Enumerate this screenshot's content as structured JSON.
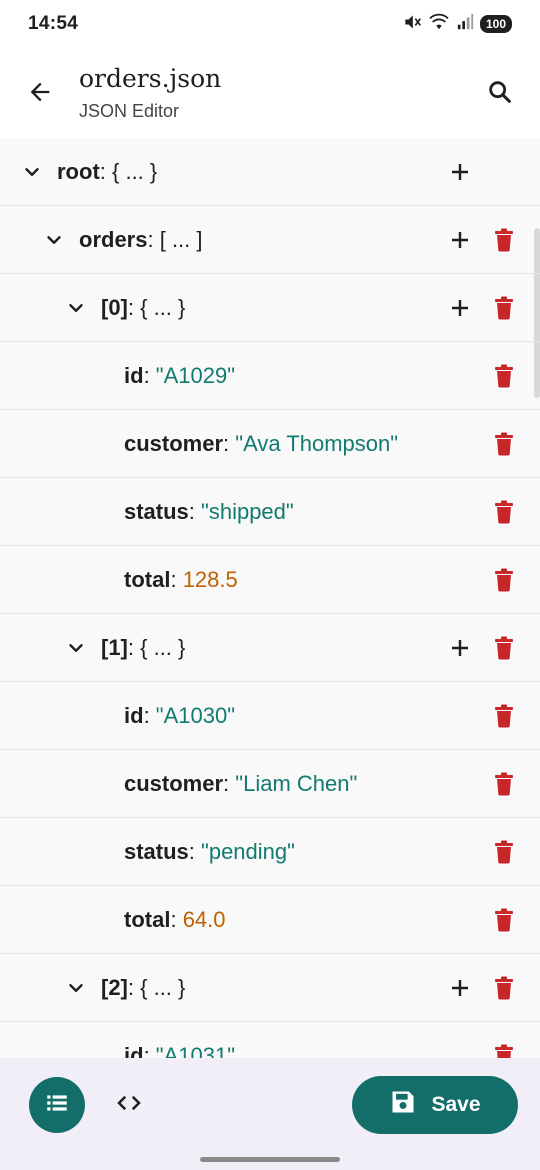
{
  "status_bar": {
    "time": "14:54",
    "battery": "100"
  },
  "app_bar": {
    "title": "orders.json",
    "subtitle": "JSON Editor"
  },
  "tree": {
    "rows": [
      {
        "key": "root",
        "sep": ": ",
        "value": "{ ... }",
        "value_type": "object"
      },
      {
        "key": "orders",
        "sep": ": ",
        "value": "[ ... ]",
        "value_type": "array"
      },
      {
        "key": "[0]",
        "sep": ": ",
        "value": "{ ... }",
        "value_type": "object"
      },
      {
        "key": "id",
        "sep": ": ",
        "value": "\"A1029\"",
        "value_type": "string"
      },
      {
        "key": "customer",
        "sep": ": ",
        "value": "\"Ava Thompson\"",
        "value_type": "string"
      },
      {
        "key": "status",
        "sep": ": ",
        "value": "\"shipped\"",
        "value_type": "string"
      },
      {
        "key": "total",
        "sep": ": ",
        "value": "128.5",
        "value_type": "number"
      },
      {
        "key": "[1]",
        "sep": ": ",
        "value": "{ ... }",
        "value_type": "object"
      },
      {
        "key": "id",
        "sep": ": ",
        "value": "\"A1030\"",
        "value_type": "string"
      },
      {
        "key": "customer",
        "sep": ": ",
        "value": "\"Liam Chen\"",
        "value_type": "string"
      },
      {
        "key": "status",
        "sep": ": ",
        "value": "\"pending\"",
        "value_type": "string"
      },
      {
        "key": "total",
        "sep": ": ",
        "value": "64.0",
        "value_type": "number"
      },
      {
        "key": "[2]",
        "sep": ": ",
        "value": "{ ... }",
        "value_type": "object"
      },
      {
        "key": "id",
        "sep": ": ",
        "value": "\"A1031\"",
        "value_type": "string"
      }
    ]
  },
  "bottom_bar": {
    "save_label": "Save"
  },
  "colors": {
    "accent": "#136e6a",
    "string_value": "#127a6e",
    "number_value": "#c06000",
    "delete": "#c62828"
  },
  "icons": [
    "arrow-back-icon",
    "search-icon",
    "chevron-down-icon",
    "add-icon",
    "delete-icon",
    "list-icon",
    "code-icon",
    "save-icon"
  ]
}
